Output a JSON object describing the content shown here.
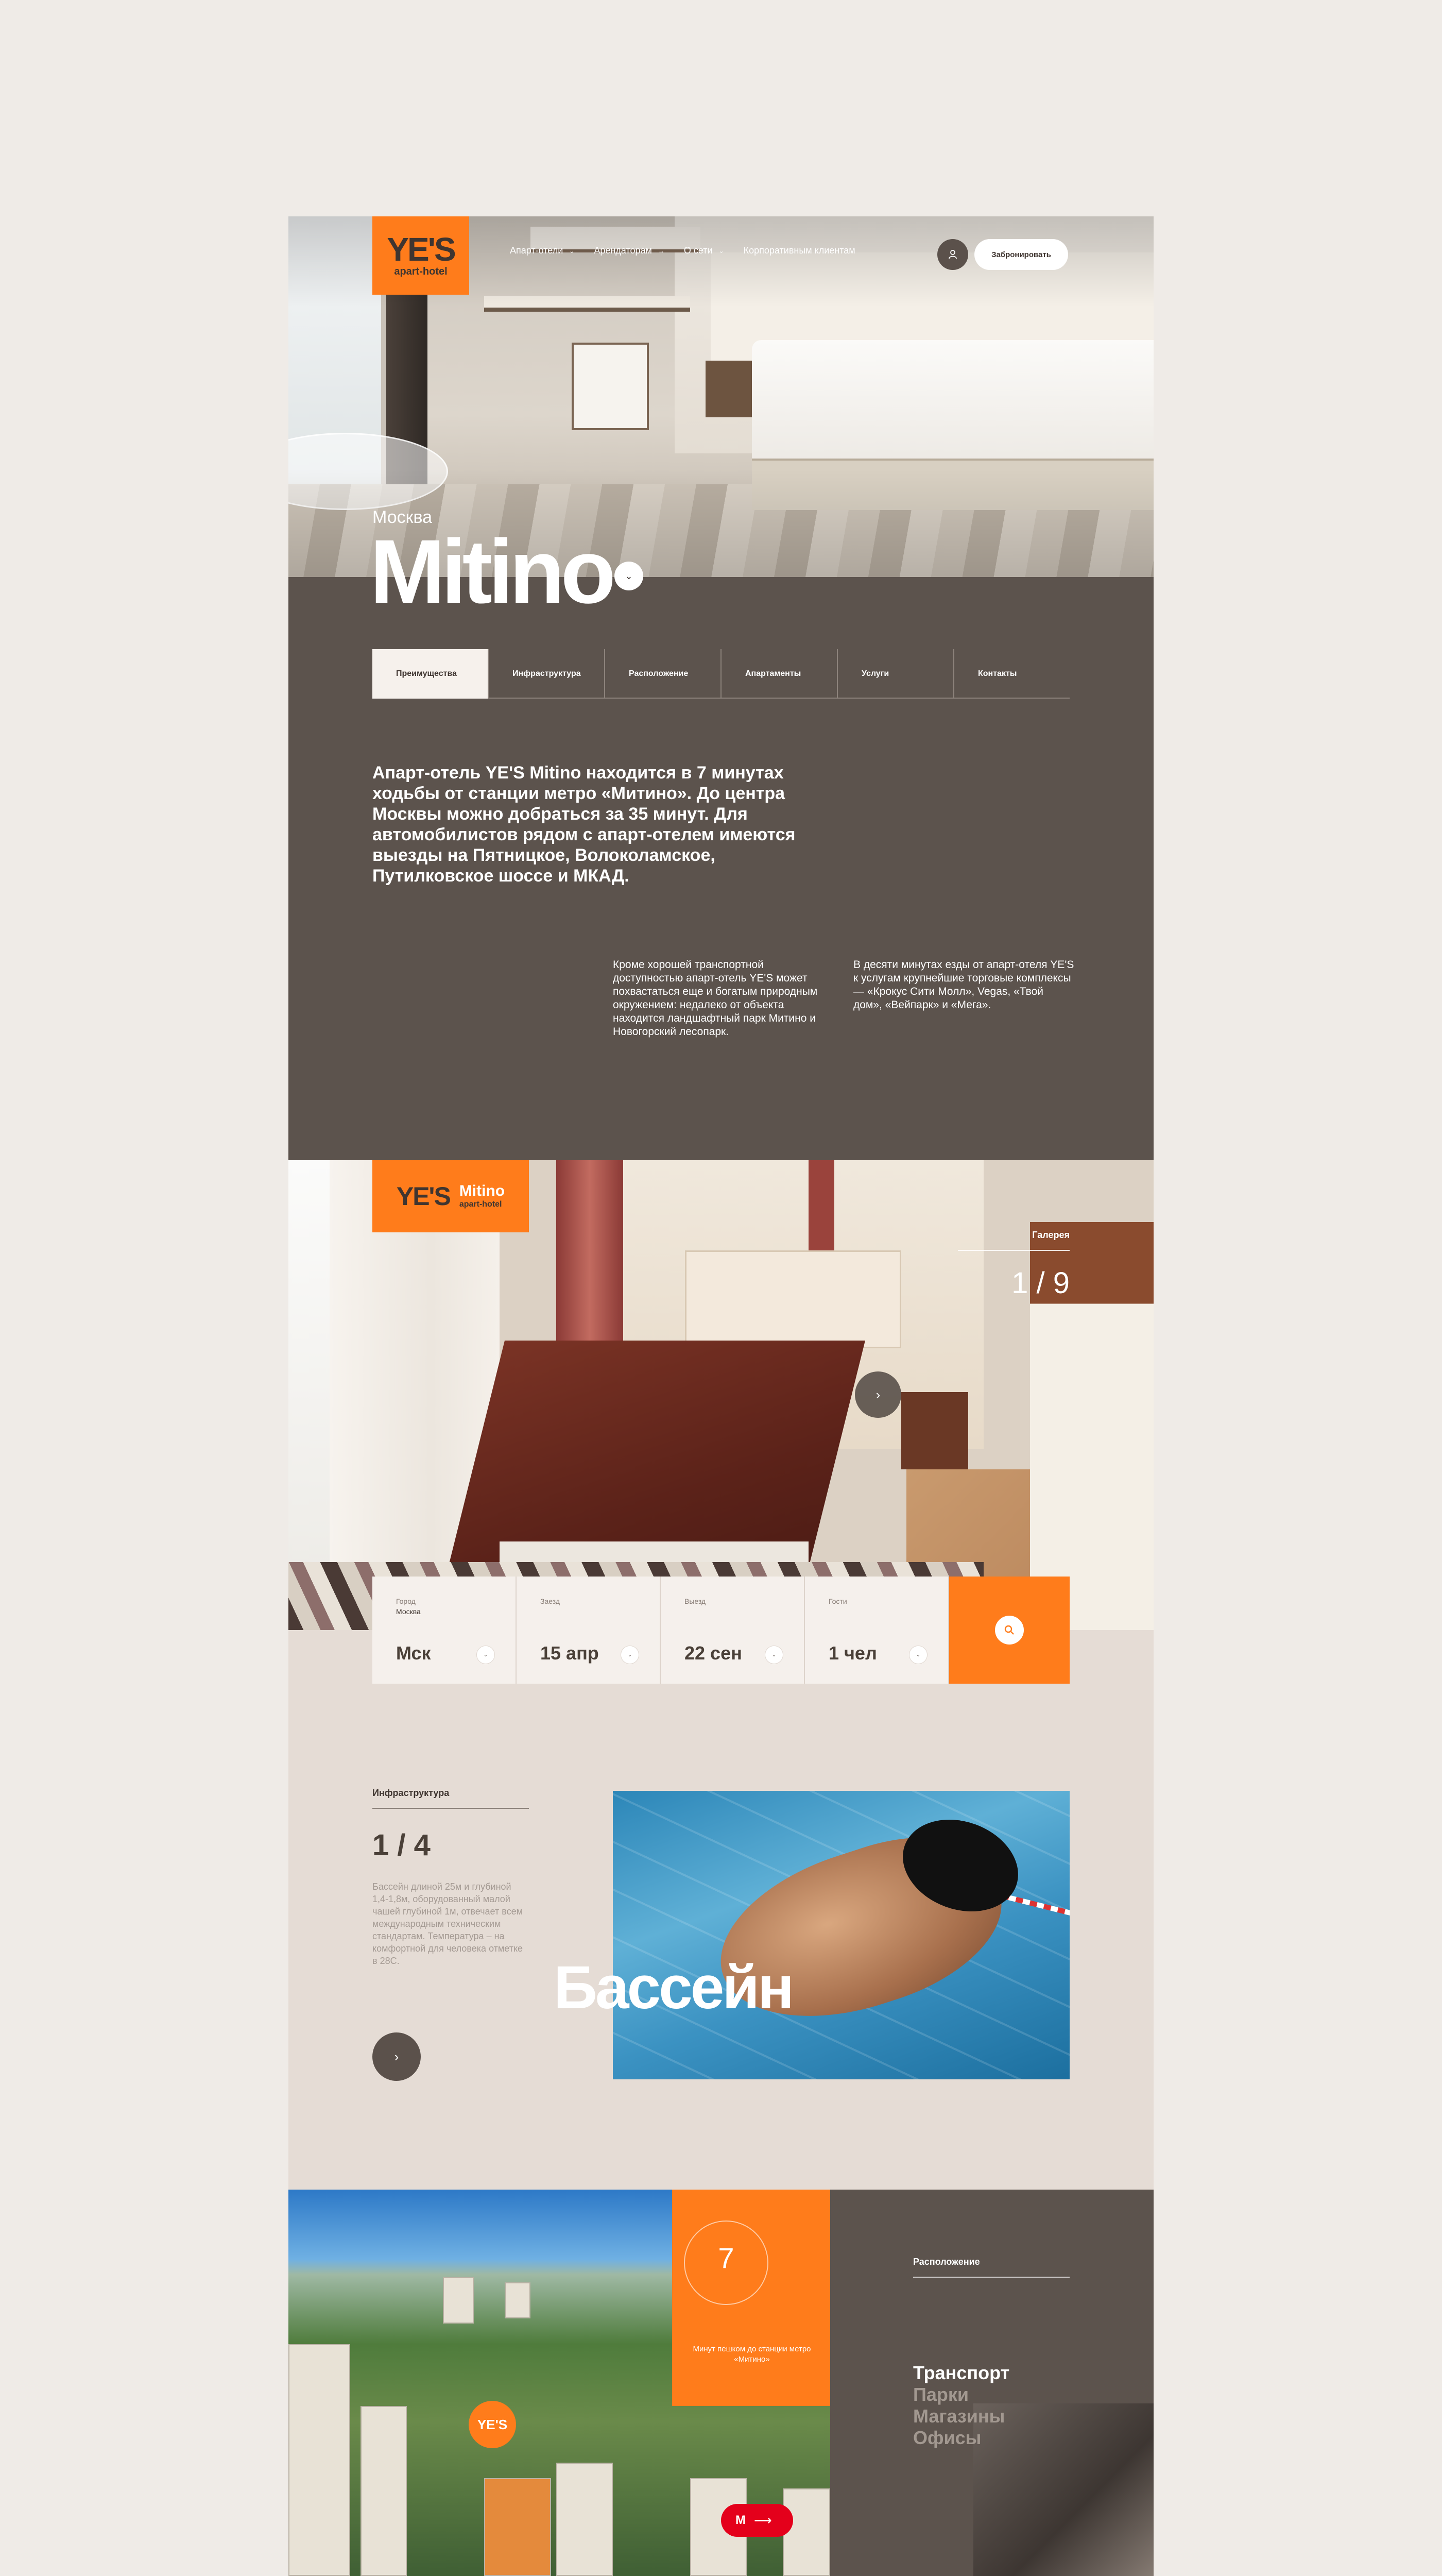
{
  "header": {
    "logo_main": "YE'S",
    "logo_sub": "apart-hotel",
    "nav": [
      {
        "label": "Апарт-отели",
        "icon": "chevron-down-icon"
      },
      {
        "label": "Арендаторам",
        "icon": "arrow-right-icon"
      },
      {
        "label": "О сети",
        "icon": "chevron-down-icon"
      },
      {
        "label": "Корпоративным клиентам",
        "icon": ""
      }
    ],
    "user_icon": "user-icon",
    "book_label": "Забронировать"
  },
  "hotel": {
    "city": "Москва",
    "name": "Mitino"
  },
  "tabs": [
    {
      "label": "Преимущества",
      "active": true
    },
    {
      "label": "Инфраструктура",
      "active": false
    },
    {
      "label": "Расположение",
      "active": false
    },
    {
      "label": "Апартаменты",
      "active": false
    },
    {
      "label": "Услуги",
      "active": false
    },
    {
      "label": "Контакты",
      "active": false
    }
  ],
  "intro": {
    "lead": "Апарт-отель YE'S Mitino находится в 7 минутах ходьбы от станции метро «Митино». До центра Москвы можно добраться за 35 минут. Для автомобилистов рядом с апарт-отелем имеются выезды на Пятницкое, Волоколамское, Путилковское шоссе и МКАД.",
    "col1": "Кроме хорошей транспортной доступностью апарт-отель YE'S может похвастаться еще и богатым природным окружением: недалеко от объекта находится ландшафтный парк Митино и Новогорский лесопарк.",
    "col2": "В десяти минутах езды от апарт-отеля YE'S к услугам крупнейшие торговые комплексы — «Крокус Сити Молл», Vegas, «Твой дом», «Вейпарк» и «Мега»."
  },
  "gallery": {
    "logo_main": "YE'S",
    "logo_name": "Mitino",
    "logo_sub": "apart-hotel",
    "label": "Галерея",
    "counter": "1 / 9"
  },
  "search": {
    "fields": [
      {
        "label": "Город",
        "sub": "Москва",
        "value": "Мск"
      },
      {
        "label": "Заезд",
        "sub": "",
        "value": "15 апр"
      },
      {
        "label": "Выезд",
        "sub": "",
        "value": "22 сен"
      },
      {
        "label": "Гости",
        "sub": "",
        "value": "1 чел"
      }
    ],
    "button_icon": "search-icon"
  },
  "infrastructure": {
    "label": "Инфраструктура",
    "counter": "1 / 4",
    "text": "Бассейн длиной 25м и глубиной 1,4-1,8м, оборудованный малой чашей глубиной 1м, отвечает всем международным техническим стандартам. Температура – на комфортной для человека отметке в 28С.",
    "title": "Бассейн"
  },
  "location": {
    "minutes": "7",
    "minutes_text": "Минут пешком до станции метро «Митино»",
    "label": "Расположение",
    "items": [
      {
        "label": "Транспорт",
        "active": true
      },
      {
        "label": "Парки",
        "active": false
      },
      {
        "label": "Магазины",
        "active": false
      },
      {
        "label": "Офисы",
        "active": false
      }
    ],
    "yes_pin": "YE'S",
    "metro_pin": "М"
  },
  "colors": {
    "accent": "#ff7c1b",
    "brown": "#5c534d",
    "page_bg": "#efebe7",
    "beige": "#e5dcd5",
    "metro": "#e4001b"
  }
}
